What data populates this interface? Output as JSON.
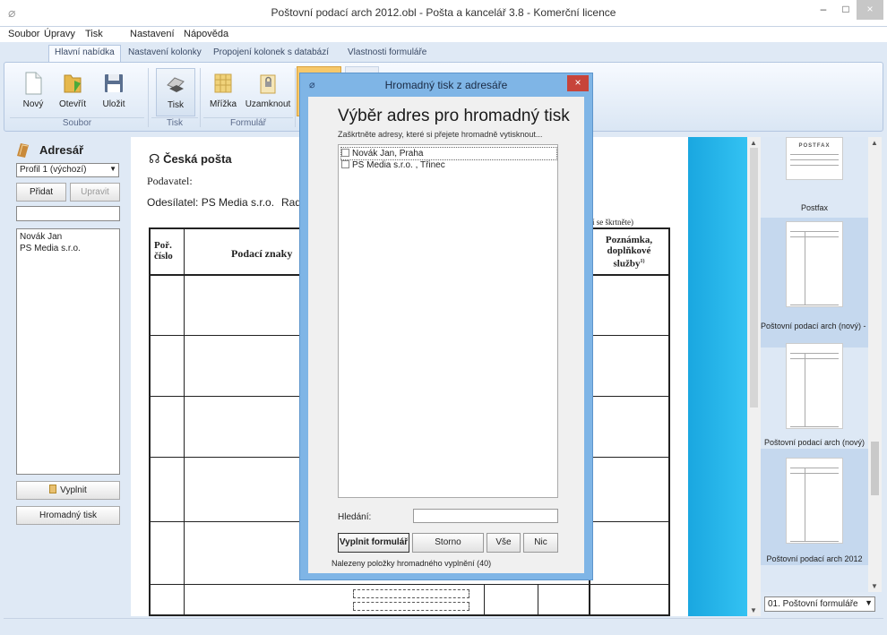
{
  "window": {
    "title": "Poštovní podací arch 2012.obl - Pošta a kancelář 3.8 - Komerční licence",
    "min": "‒",
    "max": "□",
    "close": "×"
  },
  "menu": [
    "Soubor",
    "Úpravy",
    "Tisk",
    "Nastavení",
    "Nápověda"
  ],
  "ribbon_tabs": [
    "Hlavní nabídka",
    "Nastavení kolonky",
    "Propojení kolonek s databází",
    "Vlastnosti formuláře"
  ],
  "ribbon": {
    "buttons": [
      {
        "label": "Nový",
        "icon": "new-document-icon"
      },
      {
        "label": "Otevřít",
        "icon": "open-folder-icon"
      },
      {
        "label": "Uložit",
        "icon": "save-disk-icon"
      },
      {
        "label": "Tisk",
        "icon": "printer-icon"
      },
      {
        "label": "Mřížka",
        "icon": "grid-icon"
      },
      {
        "label": "Uzamknout",
        "icon": "lock-icon"
      }
    ],
    "groups": [
      "Soubor",
      "Tisk",
      "Formulář"
    ]
  },
  "adresar": {
    "title": "Adresář",
    "profile": "Profil 1 (výchozí)",
    "add_label": "Přidat",
    "edit_label": "Upravit",
    "contacts": [
      "Novák Jan",
      "PS Media s.r.o."
    ],
    "fill_label": "Vyplnit",
    "bulk_label": "Hromadný tisk"
  },
  "document": {
    "brand": "Česká pošta",
    "podavatel": "Podavatel:",
    "odesilatel": "Odesílatel: PS Media s.r.o.",
    "rad": "Rad",
    "note_tail": "dící se škrtněte)",
    "col_por": "Poř. číslo",
    "col_znaky": "Podací znaky",
    "col_poznamka": "Poznámka, doplňkové služby",
    "sup": "1)"
  },
  "thumbnails": {
    "items": [
      "Postfax",
      "Poštovní podací arch (nový) - n",
      "Poštovní podací arch (nový)",
      "Poštovní podací arch 2012"
    ],
    "postfax_text": "POSTFAX",
    "selected": "01. Poštovní formuláře"
  },
  "dialog": {
    "title": "Hromadný tisk z adresáře",
    "heading": "Výběr adres pro hromadný tisk",
    "subtitle": "Zaškrtněte adresy, které si přejete hromadně vytisknout...",
    "addresses": [
      "Novák Jan, Praha",
      "PS Media s.r.o. , Třinec"
    ],
    "search_label": "Hledání:",
    "fill_btn": "Vyplnit formulář",
    "storno_btn": "Storno",
    "all_btn": "Vše",
    "none_btn": "Nic",
    "status": "Nalezeny položky hromadného vyplnění (40)"
  }
}
